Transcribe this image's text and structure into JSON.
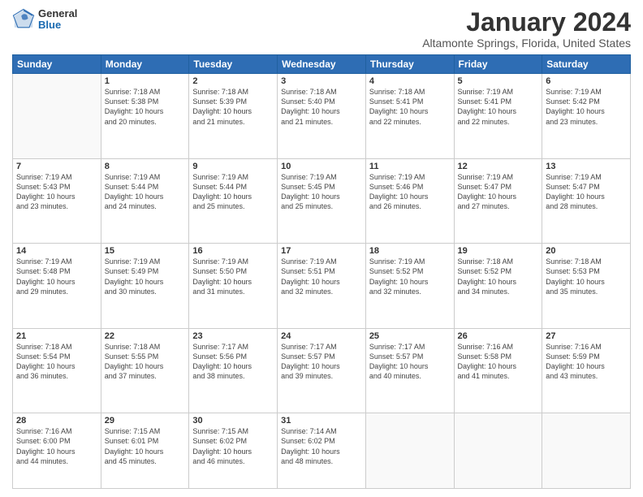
{
  "logo": {
    "general": "General",
    "blue": "Blue"
  },
  "title": "January 2024",
  "subtitle": "Altamonte Springs, Florida, United States",
  "days_of_week": [
    "Sunday",
    "Monday",
    "Tuesday",
    "Wednesday",
    "Thursday",
    "Friday",
    "Saturday"
  ],
  "weeks": [
    [
      {
        "day": "",
        "info": ""
      },
      {
        "day": "1",
        "info": "Sunrise: 7:18 AM\nSunset: 5:38 PM\nDaylight: 10 hours\nand 20 minutes."
      },
      {
        "day": "2",
        "info": "Sunrise: 7:18 AM\nSunset: 5:39 PM\nDaylight: 10 hours\nand 21 minutes."
      },
      {
        "day": "3",
        "info": "Sunrise: 7:18 AM\nSunset: 5:40 PM\nDaylight: 10 hours\nand 21 minutes."
      },
      {
        "day": "4",
        "info": "Sunrise: 7:18 AM\nSunset: 5:41 PM\nDaylight: 10 hours\nand 22 minutes."
      },
      {
        "day": "5",
        "info": "Sunrise: 7:19 AM\nSunset: 5:41 PM\nDaylight: 10 hours\nand 22 minutes."
      },
      {
        "day": "6",
        "info": "Sunrise: 7:19 AM\nSunset: 5:42 PM\nDaylight: 10 hours\nand 23 minutes."
      }
    ],
    [
      {
        "day": "7",
        "info": "Sunrise: 7:19 AM\nSunset: 5:43 PM\nDaylight: 10 hours\nand 23 minutes."
      },
      {
        "day": "8",
        "info": "Sunrise: 7:19 AM\nSunset: 5:44 PM\nDaylight: 10 hours\nand 24 minutes."
      },
      {
        "day": "9",
        "info": "Sunrise: 7:19 AM\nSunset: 5:44 PM\nDaylight: 10 hours\nand 25 minutes."
      },
      {
        "day": "10",
        "info": "Sunrise: 7:19 AM\nSunset: 5:45 PM\nDaylight: 10 hours\nand 25 minutes."
      },
      {
        "day": "11",
        "info": "Sunrise: 7:19 AM\nSunset: 5:46 PM\nDaylight: 10 hours\nand 26 minutes."
      },
      {
        "day": "12",
        "info": "Sunrise: 7:19 AM\nSunset: 5:47 PM\nDaylight: 10 hours\nand 27 minutes."
      },
      {
        "day": "13",
        "info": "Sunrise: 7:19 AM\nSunset: 5:47 PM\nDaylight: 10 hours\nand 28 minutes."
      }
    ],
    [
      {
        "day": "14",
        "info": "Sunrise: 7:19 AM\nSunset: 5:48 PM\nDaylight: 10 hours\nand 29 minutes."
      },
      {
        "day": "15",
        "info": "Sunrise: 7:19 AM\nSunset: 5:49 PM\nDaylight: 10 hours\nand 30 minutes."
      },
      {
        "day": "16",
        "info": "Sunrise: 7:19 AM\nSunset: 5:50 PM\nDaylight: 10 hours\nand 31 minutes."
      },
      {
        "day": "17",
        "info": "Sunrise: 7:19 AM\nSunset: 5:51 PM\nDaylight: 10 hours\nand 32 minutes."
      },
      {
        "day": "18",
        "info": "Sunrise: 7:19 AM\nSunset: 5:52 PM\nDaylight: 10 hours\nand 32 minutes."
      },
      {
        "day": "19",
        "info": "Sunrise: 7:18 AM\nSunset: 5:52 PM\nDaylight: 10 hours\nand 34 minutes."
      },
      {
        "day": "20",
        "info": "Sunrise: 7:18 AM\nSunset: 5:53 PM\nDaylight: 10 hours\nand 35 minutes."
      }
    ],
    [
      {
        "day": "21",
        "info": "Sunrise: 7:18 AM\nSunset: 5:54 PM\nDaylight: 10 hours\nand 36 minutes."
      },
      {
        "day": "22",
        "info": "Sunrise: 7:18 AM\nSunset: 5:55 PM\nDaylight: 10 hours\nand 37 minutes."
      },
      {
        "day": "23",
        "info": "Sunrise: 7:17 AM\nSunset: 5:56 PM\nDaylight: 10 hours\nand 38 minutes."
      },
      {
        "day": "24",
        "info": "Sunrise: 7:17 AM\nSunset: 5:57 PM\nDaylight: 10 hours\nand 39 minutes."
      },
      {
        "day": "25",
        "info": "Sunrise: 7:17 AM\nSunset: 5:57 PM\nDaylight: 10 hours\nand 40 minutes."
      },
      {
        "day": "26",
        "info": "Sunrise: 7:16 AM\nSunset: 5:58 PM\nDaylight: 10 hours\nand 41 minutes."
      },
      {
        "day": "27",
        "info": "Sunrise: 7:16 AM\nSunset: 5:59 PM\nDaylight: 10 hours\nand 43 minutes."
      }
    ],
    [
      {
        "day": "28",
        "info": "Sunrise: 7:16 AM\nSunset: 6:00 PM\nDaylight: 10 hours\nand 44 minutes."
      },
      {
        "day": "29",
        "info": "Sunrise: 7:15 AM\nSunset: 6:01 PM\nDaylight: 10 hours\nand 45 minutes."
      },
      {
        "day": "30",
        "info": "Sunrise: 7:15 AM\nSunset: 6:02 PM\nDaylight: 10 hours\nand 46 minutes."
      },
      {
        "day": "31",
        "info": "Sunrise: 7:14 AM\nSunset: 6:02 PM\nDaylight: 10 hours\nand 48 minutes."
      },
      {
        "day": "",
        "info": ""
      },
      {
        "day": "",
        "info": ""
      },
      {
        "day": "",
        "info": ""
      }
    ]
  ]
}
